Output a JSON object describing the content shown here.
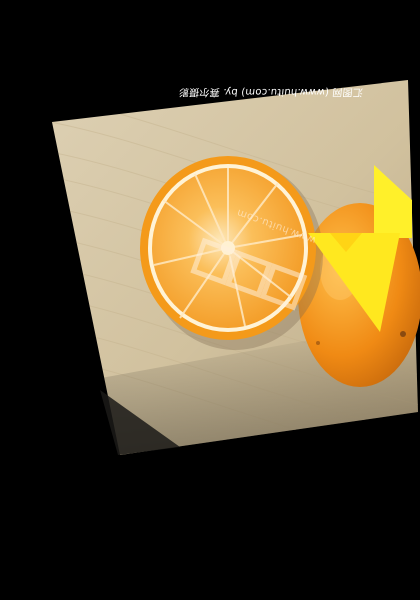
{
  "photo": {
    "subject": "Sliced orange on a wooden table",
    "caption": "汇图网 (www.huitu.com) by. 赛尔摄影",
    "watermark_url": "www.huitu.com"
  },
  "colors": {
    "background": "#000000",
    "table": "#d6c6a4",
    "orange_peel": "#f29a1c",
    "orange_flesh": "#f7a93a",
    "sticker": "#ffef2a"
  }
}
